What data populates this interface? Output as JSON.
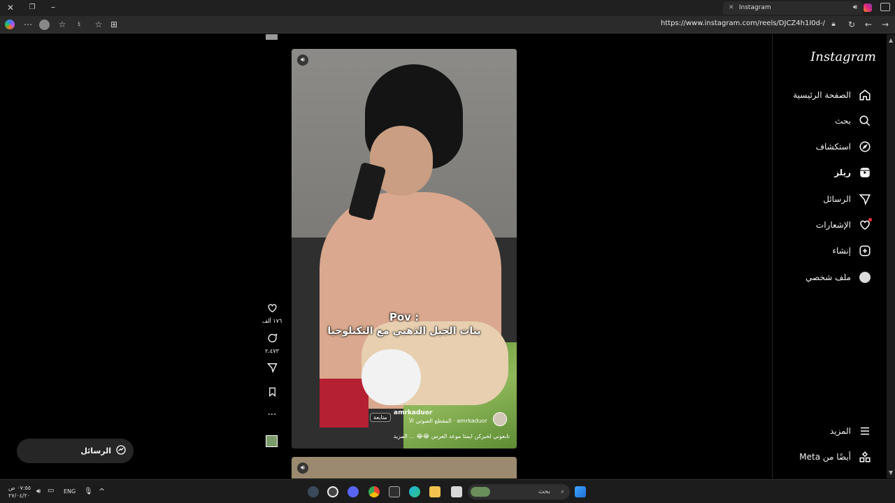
{
  "browser": {
    "tab_title": "Instagram",
    "url": "https://www.instagram.com/reels/DJCZ4h1I0d-/"
  },
  "sidebar": {
    "logo": "Instagram",
    "items": [
      {
        "label": "الصفحة الرئيسية",
        "icon": "home-icon"
      },
      {
        "label": "بحث",
        "icon": "search-icon"
      },
      {
        "label": "استكشاف",
        "icon": "compass-icon"
      },
      {
        "label": "ريلز",
        "icon": "reels-icon"
      },
      {
        "label": "الرسائل",
        "icon": "send-icon"
      },
      {
        "label": "الإشعارات",
        "icon": "heart-icon"
      },
      {
        "label": "إنشاء",
        "icon": "plus-icon"
      },
      {
        "label": "ملف شخصي",
        "icon": "profile-icon"
      }
    ],
    "more": "المزيد",
    "meta": "أيضًا من Meta"
  },
  "reel": {
    "caption_line1": "Pov :",
    "caption_line2": "بنات الجيل الذهبي مع التكنلوجيا",
    "author": "amrkaduor",
    "follow": "متابعة",
    "audio": "amrkaduor · المقطع الصوتي الأ",
    "description": "تابعوني لخبركن ايمتا موعد العرس 😂😂 ... المزيد"
  },
  "actions": {
    "likes": "١٧٦ ألف",
    "comments": "٢،٤٧٣"
  },
  "messages_pill": {
    "label": "الرسائل"
  },
  "taskbar": {
    "search_placeholder": "بحث",
    "lang": "ENG",
    "time": "٠٧:٥٥ ص",
    "date": "٢٧/٠٤/٢٠"
  }
}
